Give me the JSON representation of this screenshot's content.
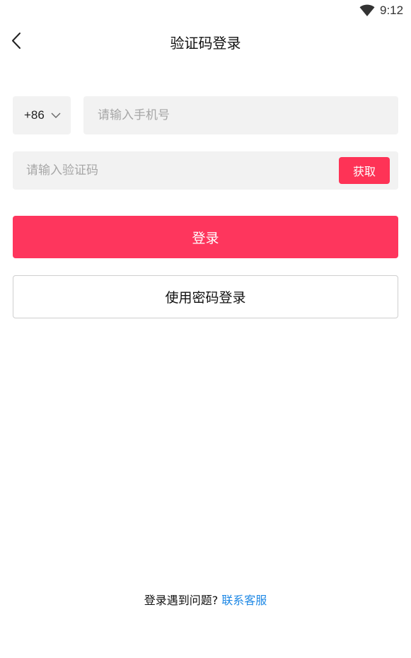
{
  "status_bar": {
    "time": "9:12",
    "wifi_icon": "wifi-icon"
  },
  "header": {
    "back_icon": "back-arrow-icon",
    "title": "验证码登录"
  },
  "phone": {
    "country_code": "+86",
    "country_code_icon": "chevron-down-icon",
    "placeholder": "请输入手机号",
    "value": ""
  },
  "verification": {
    "placeholder": "请输入验证码",
    "value": "",
    "get_code_label": "获取"
  },
  "actions": {
    "login_label": "登录",
    "password_login_label": "使用密码登录"
  },
  "footer": {
    "help_text": "登录遇到问题?",
    "contact_link": "联系客服"
  },
  "colors": {
    "accent": "#fe365d",
    "input_background": "#f2f2f2",
    "link": "#1e88e5",
    "placeholder": "#a6a6a6"
  }
}
